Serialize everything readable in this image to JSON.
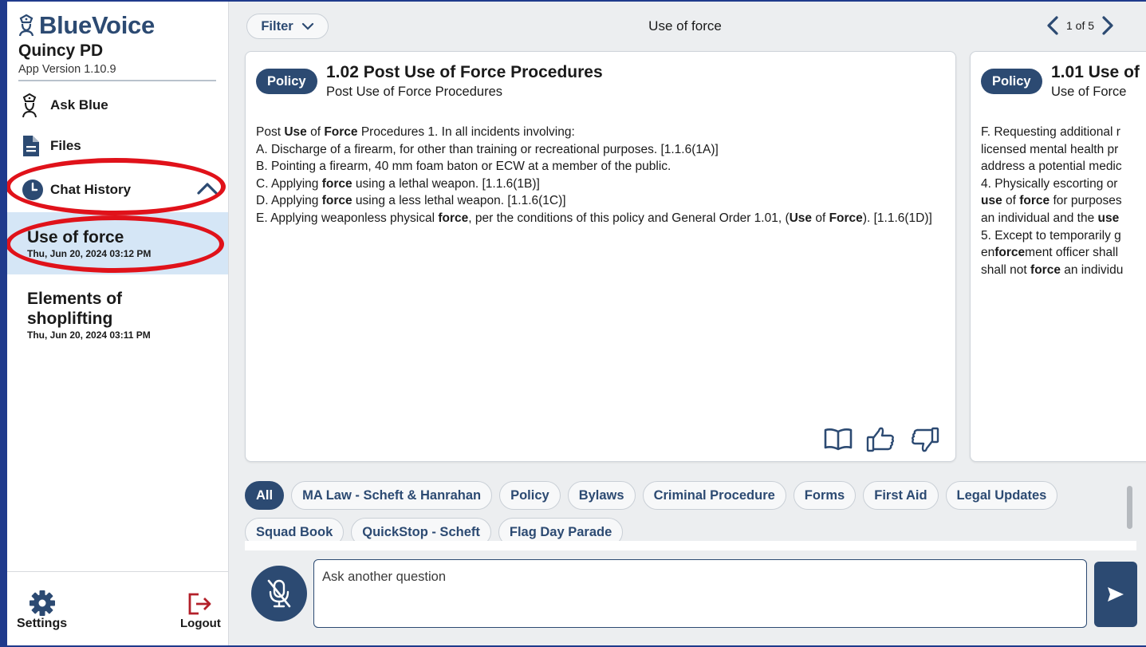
{
  "sidebar": {
    "brand": "BlueVoice",
    "department": "Quincy PD",
    "version": "App Version 1.10.9",
    "nav": {
      "ask_blue": "Ask Blue",
      "files": "Files",
      "chat_history": "Chat History"
    },
    "history": [
      {
        "title": "Use of force",
        "date": "Thu, Jun 20, 2024 03:12 PM"
      },
      {
        "title": "Elements of shoplifting",
        "date": "Thu, Jun 20, 2024 03:11 PM"
      }
    ],
    "settings_label": "Settings",
    "logout_label": "Logout"
  },
  "header": {
    "filter_label": "Filter",
    "topic": "Use of force",
    "pager": "1 of 5"
  },
  "cards": [
    {
      "badge": "Policy",
      "title": "1.02 Post Use of Force Procedures",
      "subtitle": "Post Use of Force Procedures"
    },
    {
      "badge": "Policy",
      "title": "1.01 Use of",
      "subtitle": "Use of Force"
    }
  ],
  "chips": [
    "All",
    "MA Law - Scheft & Hanrahan",
    "Policy",
    "Bylaws",
    "Criminal Procedure",
    "Forms",
    "First Aid",
    "Legal Updates",
    "Squad Book",
    "QuickStop - Scheft",
    "Flag Day Parade"
  ],
  "input": {
    "placeholder": "Ask another question"
  },
  "colors": {
    "brand": "#2c4a72",
    "annotation": "#e0121a",
    "selected_row": "#d5e6f6",
    "logout": "#b3202a"
  }
}
